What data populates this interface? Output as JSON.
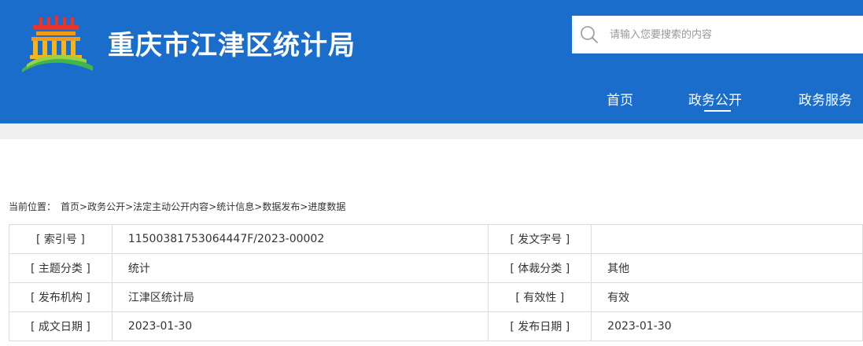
{
  "header": {
    "site_title": "重庆市江津区统计局",
    "colors": {
      "header_bg": "#1b6dcc",
      "band_bg": "#f0f0f0"
    }
  },
  "search": {
    "placeholder": "请输入您要搜索的内容",
    "icon": "search-icon"
  },
  "nav": {
    "items": [
      {
        "label": "首页"
      },
      {
        "label": "政务公开",
        "active": true
      },
      {
        "label": "政务服务"
      }
    ]
  },
  "breadcrumb": {
    "prefix": "当前位置：",
    "items": [
      "首页",
      "政务公开",
      "法定主动公开内容",
      "统计信息",
      "数据发布",
      "进度数据"
    ],
    "separator": ">"
  },
  "info_table": {
    "rows": [
      {
        "label1": "[ 索引号 ]",
        "value1": "11500381753064447F/2023-00002",
        "label2": "[ 发文字号 ]",
        "value2": ""
      },
      {
        "label1": "[ 主题分类 ]",
        "value1": "统计",
        "label2": "[ 体裁分类 ]",
        "value2": "其他"
      },
      {
        "label1": "[ 发布机构 ]",
        "value1": "江津区统计局",
        "label2": "[ 有效性 ]",
        "value2": "有效"
      },
      {
        "label1": "[ 成文日期 ]",
        "value1": "2023-01-30",
        "label2": "[ 发布日期 ]",
        "value2": "2023-01-30"
      }
    ]
  }
}
